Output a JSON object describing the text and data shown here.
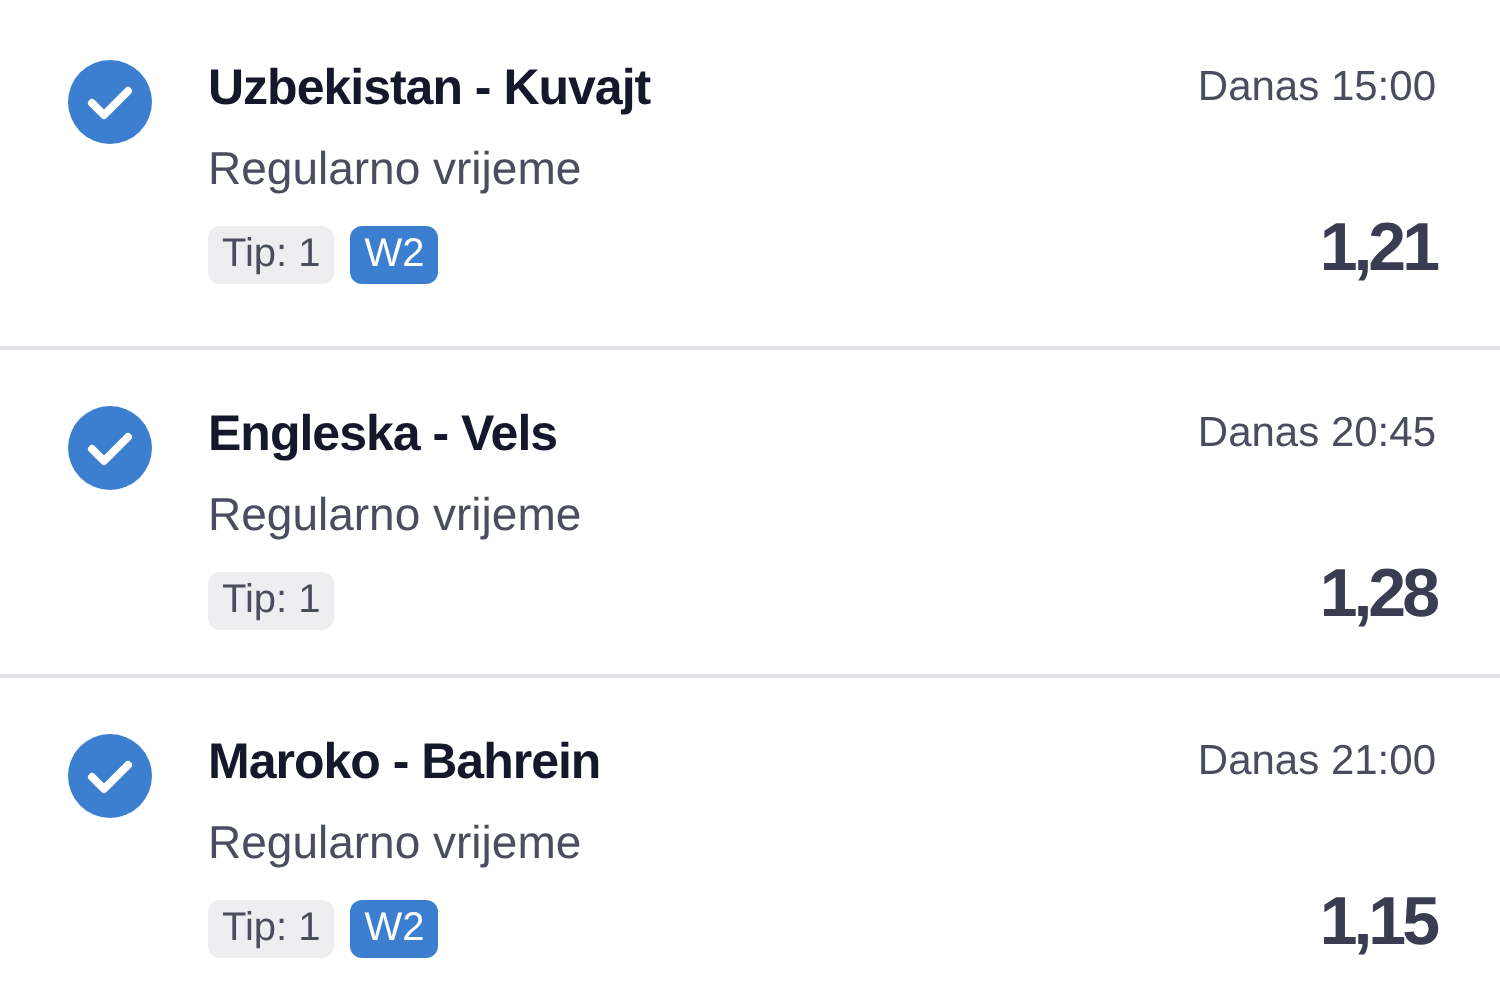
{
  "bets": [
    {
      "match": "Uzbekistan - Kuvajt",
      "checked": true,
      "time": "Danas 15:00",
      "market": "Regularno vrijeme",
      "tags": [
        {
          "kind": "tip",
          "text": "Tip: 1"
        },
        {
          "kind": "badge",
          "text": "W2"
        }
      ],
      "odds": "1,21"
    },
    {
      "match": "Engleska - Vels",
      "checked": true,
      "time": "Danas 20:45",
      "market": "Regularno vrijeme",
      "tags": [
        {
          "kind": "tip",
          "text": "Tip: 1"
        }
      ],
      "odds": "1,28"
    },
    {
      "match": "Maroko - Bahrein",
      "checked": true,
      "time": "Danas 21:00",
      "market": "Regularno vrijeme",
      "tags": [
        {
          "kind": "tip",
          "text": "Tip: 1"
        },
        {
          "kind": "badge",
          "text": "W2"
        }
      ],
      "odds": "1,15"
    }
  ]
}
